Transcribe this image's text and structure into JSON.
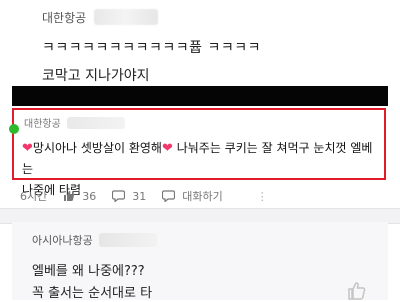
{
  "post": {
    "author": "대한항공",
    "line1": "ㅋㅋㅋㅋㅋㅋㅋㅋㅋㅋㅋ퓹 ㅋㅋㅋㅋ",
    "line2": "코막고 지나가야지"
  },
  "highlight_comment": {
    "author": "대한항공",
    "heart_1": "❤",
    "text_1": "망시아나 셋방살이 환영해",
    "heart_2": "❤",
    "text_2": " 나눠주는 쿠키는 잘 쳐먹구 눈치껏 엘베는",
    "text_3": "나중에 타렴"
  },
  "stats": {
    "time": "6시간",
    "likes": "36",
    "comments": "31",
    "reply_label": "대화하기"
  },
  "reply": {
    "author": "아시아나항공",
    "line1": "엘베를 왜 나중에???",
    "line2": "꼭 출서는 순서대로 타"
  },
  "colors": {
    "highlight_border": "#e21b2a",
    "heart": "#f0386b",
    "dot": "#2dbb2d"
  }
}
